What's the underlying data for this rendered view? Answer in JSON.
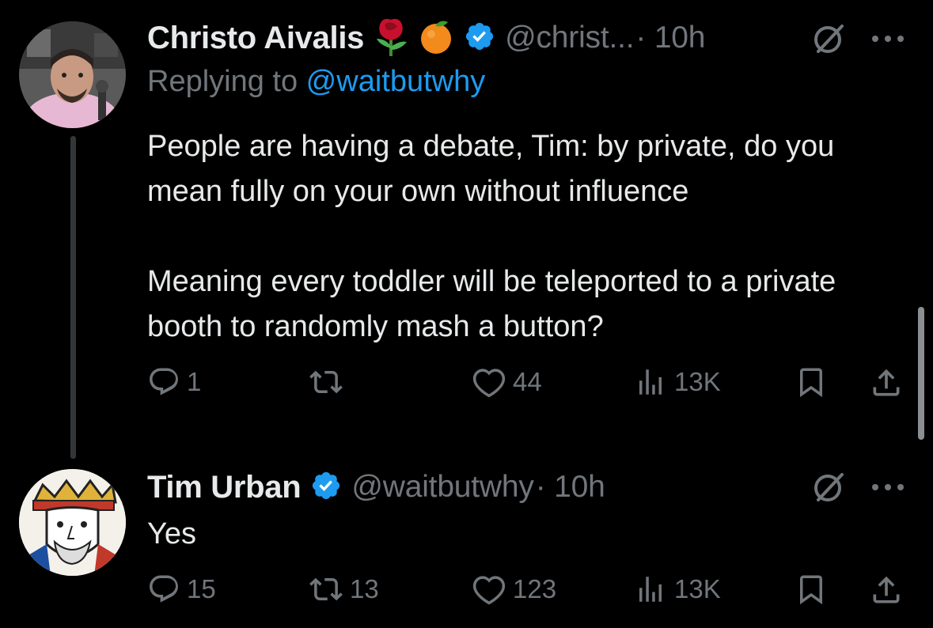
{
  "tweets": [
    {
      "author_name": "Christo Aivalis",
      "handle": "@christ...",
      "time": "· 10h",
      "replying_label": "Replying to ",
      "replying_handle": "@waitbutwhy",
      "text": "People are having a debate, Tim: by private, do you mean fully on your own without influence\n\nMeaning every toddler will be teleported to a private booth to randomly mash a button?",
      "replies": "1",
      "retweets": "",
      "likes": "44",
      "views": "13K"
    },
    {
      "author_name": "Tim Urban",
      "handle": "@waitbutwhy",
      "time": "· 10h",
      "text": "Yes",
      "replies": "15",
      "retweets": "13",
      "likes": "123",
      "views": "13K"
    }
  ],
  "icons": {
    "rose": "rose-emoji",
    "orange": "orange-emoji",
    "verified": "verified-badge-icon",
    "grok": "grok-icon",
    "more": "more-icon",
    "reply": "reply-icon",
    "retweet": "retweet-icon",
    "like": "heart-icon",
    "views": "views-icon",
    "bookmark": "bookmark-icon",
    "share": "share-icon"
  },
  "colors": {
    "background": "#000000",
    "text": "#e7e9ea",
    "muted": "#71767b",
    "link": "#1d9bf0",
    "verified": "#1d9bf0"
  }
}
